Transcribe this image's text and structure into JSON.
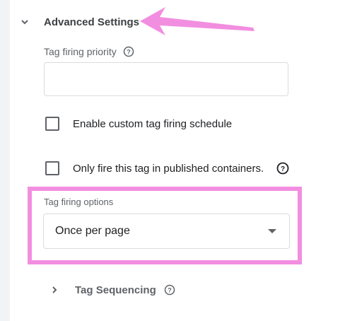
{
  "advanced": {
    "title": "Advanced Settings",
    "expanded_icon": "chevron-down-icon"
  },
  "priority": {
    "label": "Tag firing priority",
    "value": "",
    "placeholder": "",
    "help_icon": "help-circle-icon"
  },
  "schedule": {
    "label": "Enable custom tag firing schedule",
    "checked": false
  },
  "published_only": {
    "label": "Only fire this tag in published containers.",
    "checked": false,
    "help_icon": "help-circle-icon"
  },
  "firing_options": {
    "label": "Tag firing options",
    "selected": "Once per page",
    "dropdown_icon": "dropdown-arrow-icon"
  },
  "sequencing": {
    "label": "Tag Sequencing",
    "collapsed_icon": "chevron-right-icon",
    "help_icon": "help-circle-icon"
  },
  "annotations": {
    "highlight_color": "#f28ee0",
    "arrow_color": "#f28ee0"
  }
}
